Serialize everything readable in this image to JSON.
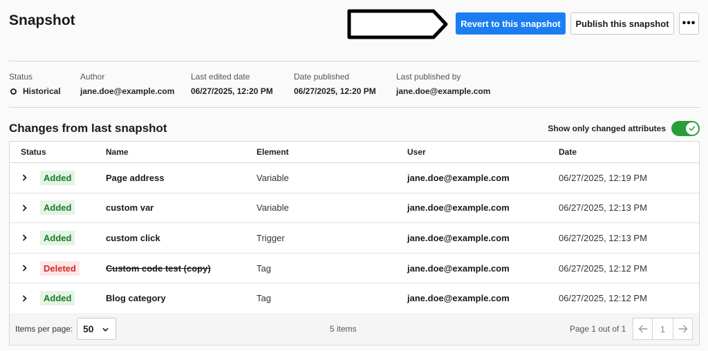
{
  "page": {
    "title": "Snapshot"
  },
  "toolbar": {
    "revert_label": "Revert to this snapshot",
    "publish_label": "Publish this snapshot",
    "more_label": "•••"
  },
  "meta": {
    "status": {
      "label": "Status",
      "value": "Historical"
    },
    "author": {
      "label": "Author",
      "value": "jane.doe@example.com"
    },
    "last_edited": {
      "label": "Last edited date",
      "value": "06/27/2025, 12:20 PM"
    },
    "date_published": {
      "label": "Date published",
      "value": "06/27/2025, 12:20 PM"
    },
    "last_published_by": {
      "label": "Last published by",
      "value": "jane.doe@example.com"
    }
  },
  "changes": {
    "title": "Changes from last snapshot",
    "toggle_label": "Show only changed attributes",
    "toggle_on": true,
    "columns": {
      "status": "Status",
      "name": "Name",
      "element": "Element",
      "user": "User",
      "date": "Date"
    },
    "rows": [
      {
        "status": "Added",
        "name": "Page address",
        "element": "Variable",
        "user": "jane.doe@example.com",
        "date": "06/27/2025, 12:19 PM"
      },
      {
        "status": "Added",
        "name": "custom var",
        "element": "Variable",
        "user": "jane.doe@example.com",
        "date": "06/27/2025, 12:13 PM"
      },
      {
        "status": "Added",
        "name": "custom click",
        "element": "Trigger",
        "user": "jane.doe@example.com",
        "date": "06/27/2025, 12:13 PM"
      },
      {
        "status": "Deleted",
        "name": "Custom code test (copy)",
        "element": "Tag",
        "user": "jane.doe@example.com",
        "date": "06/27/2025, 12:12 PM"
      },
      {
        "status": "Added",
        "name": "Blog category",
        "element": "Tag",
        "user": "jane.doe@example.com",
        "date": "06/27/2025, 12:12 PM"
      }
    ]
  },
  "pagination": {
    "items_per_page_label": "Items per page:",
    "items_per_page": "50",
    "item_count": "5 items",
    "page_info": "Page 1 out of 1",
    "current_page": "1"
  },
  "colors": {
    "primary": "#1a7ef2",
    "added_text": "#1b7a2a",
    "added_bg": "#e3f4e4",
    "deleted_text": "#d42828",
    "deleted_bg": "#fde7e7",
    "toggle_on": "#2a9d3a"
  },
  "icons": {
    "more": "more-horizontal-icon",
    "expand": "chevron-right-icon",
    "select": "chevron-down-icon",
    "prev": "arrow-left-icon",
    "next": "arrow-right-icon",
    "toggle": "check-icon",
    "status": "circle-outline-icon"
  }
}
